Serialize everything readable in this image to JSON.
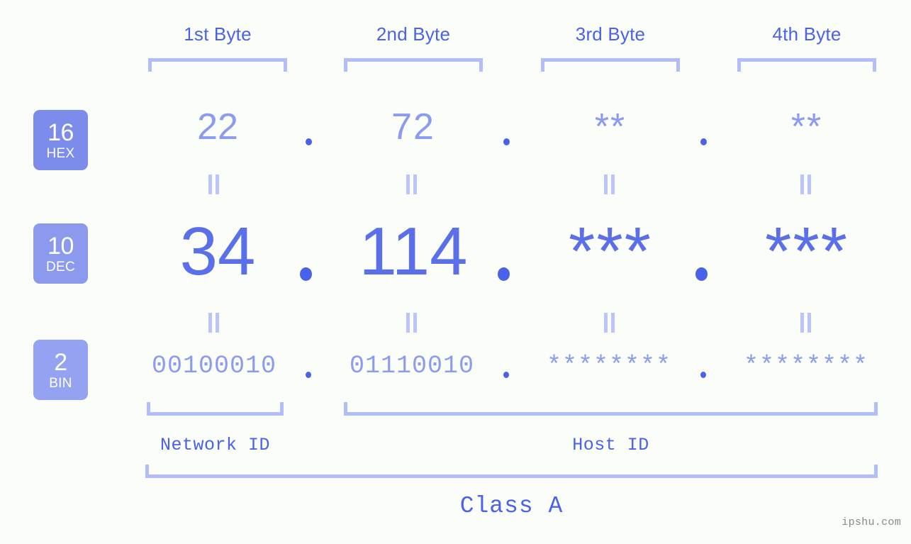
{
  "background_color": "#fbfdf8",
  "accent_color": "#4a62ea",
  "bracket_color": "#b3bdf9",
  "byte_headers": [
    {
      "label": "1st Byte"
    },
    {
      "label": "2nd Byte"
    },
    {
      "label": "3rd Byte"
    },
    {
      "label": "4th Byte"
    }
  ],
  "rows": {
    "hex": {
      "badge_number": "16",
      "badge_name": "HEX",
      "badge_color": "#7b8cea",
      "values": [
        "22",
        "72",
        "**",
        "**"
      ],
      "separator": "."
    },
    "dec": {
      "badge_number": "10",
      "badge_name": "DEC",
      "badge_color": "#8b9aed",
      "values": [
        "34",
        "114",
        "***",
        "***"
      ],
      "separator": "."
    },
    "bin": {
      "badge_number": "2",
      "badge_name": "BIN",
      "badge_color": "#93a3f2",
      "values": [
        "00100010",
        "01110010",
        "********",
        "********"
      ],
      "separator": "."
    }
  },
  "equals_symbol": "=",
  "footer": {
    "network_id_label": "Network ID",
    "host_id_label": "Host ID",
    "class_label": "Class A",
    "watermark": "ipshu.com"
  }
}
